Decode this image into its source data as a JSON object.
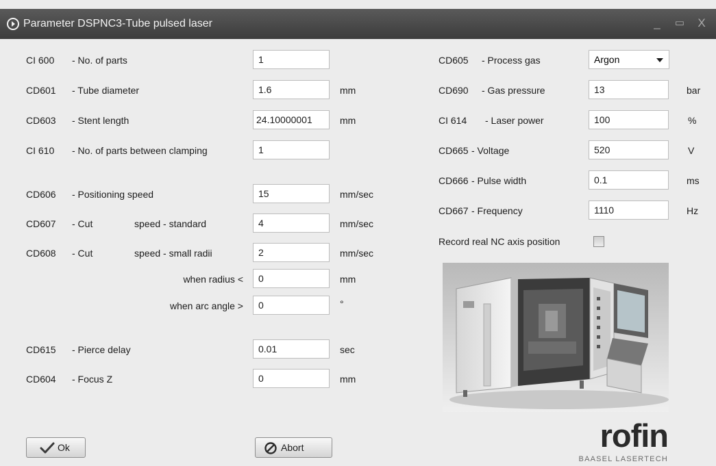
{
  "window": {
    "title": "Parameter DSPNC3-Tube pulsed laser",
    "minimize_glyph": "_",
    "maximize_glyph": "▭",
    "close_glyph": "X"
  },
  "left": [
    {
      "code": "CI 600",
      "label": "- No. of parts",
      "value": "1",
      "unit": ""
    },
    {
      "code": "CD601",
      "label": "- Tube diameter",
      "value": "1.6",
      "unit": "mm"
    },
    {
      "code": "CD603",
      "label": "- Stent length",
      "value": "24.10000001",
      "unit": "mm"
    },
    {
      "code": "CI 610",
      "label": "- No. of parts between clamping",
      "value": "1",
      "unit": ""
    },
    {
      "code": "CD606",
      "label": "- Positioning speed",
      "value": "15",
      "unit": "mm/sec"
    },
    {
      "code": "CD607",
      "label": "- Cut",
      "label2": "speed - standard",
      "value": "4",
      "unit": "mm/sec"
    },
    {
      "code": "CD608",
      "label": "- Cut",
      "label2": "speed - small radii",
      "value": "2",
      "unit": "mm/sec"
    },
    {
      "code": "",
      "label": "when radius  <",
      "value": "0",
      "unit": "mm"
    },
    {
      "code": "",
      "label": "when arc angle  >",
      "value": "0",
      "unit": "°"
    },
    {
      "code": "CD615",
      "label": "- Pierce  delay",
      "value": "0.01",
      "unit": "sec"
    },
    {
      "code": "CD604",
      "label": "- Focus Z",
      "value": "0",
      "unit": "mm"
    }
  ],
  "right": [
    {
      "code": "CD605",
      "label": "- Process gas",
      "value": "Argon",
      "unit": ""
    },
    {
      "code": "CD690",
      "label": "- Gas pressure",
      "value": "13",
      "unit": "bar"
    },
    {
      "code": "CI 614",
      "label": "- Laser power",
      "value": "100",
      "unit": "%"
    },
    {
      "code": "CD665",
      "label": "- Voltage",
      "value": "520",
      "unit": "V"
    },
    {
      "code": "CD666",
      "label": "- Pulse width",
      "value": "0.1",
      "unit": "ms"
    },
    {
      "code": "CD667",
      "label": "- Frequency",
      "value": "1110",
      "unit": "Hz"
    }
  ],
  "record_label": "Record real NC axis position",
  "record_checked": false,
  "buttons": {
    "ok": "Ok",
    "abort": "Abort"
  },
  "logo": {
    "name": "rofin",
    "sub": "BAASEL LASERTECH"
  },
  "icons": {
    "title": "app-circle-icon",
    "ok": "checkmark-icon",
    "abort": "prohibit-icon",
    "dropdown": "chevron-down-icon"
  },
  "colors": {
    "titlebar": "#4a4a4a",
    "background": "#ececec",
    "input": "#ffffff"
  }
}
